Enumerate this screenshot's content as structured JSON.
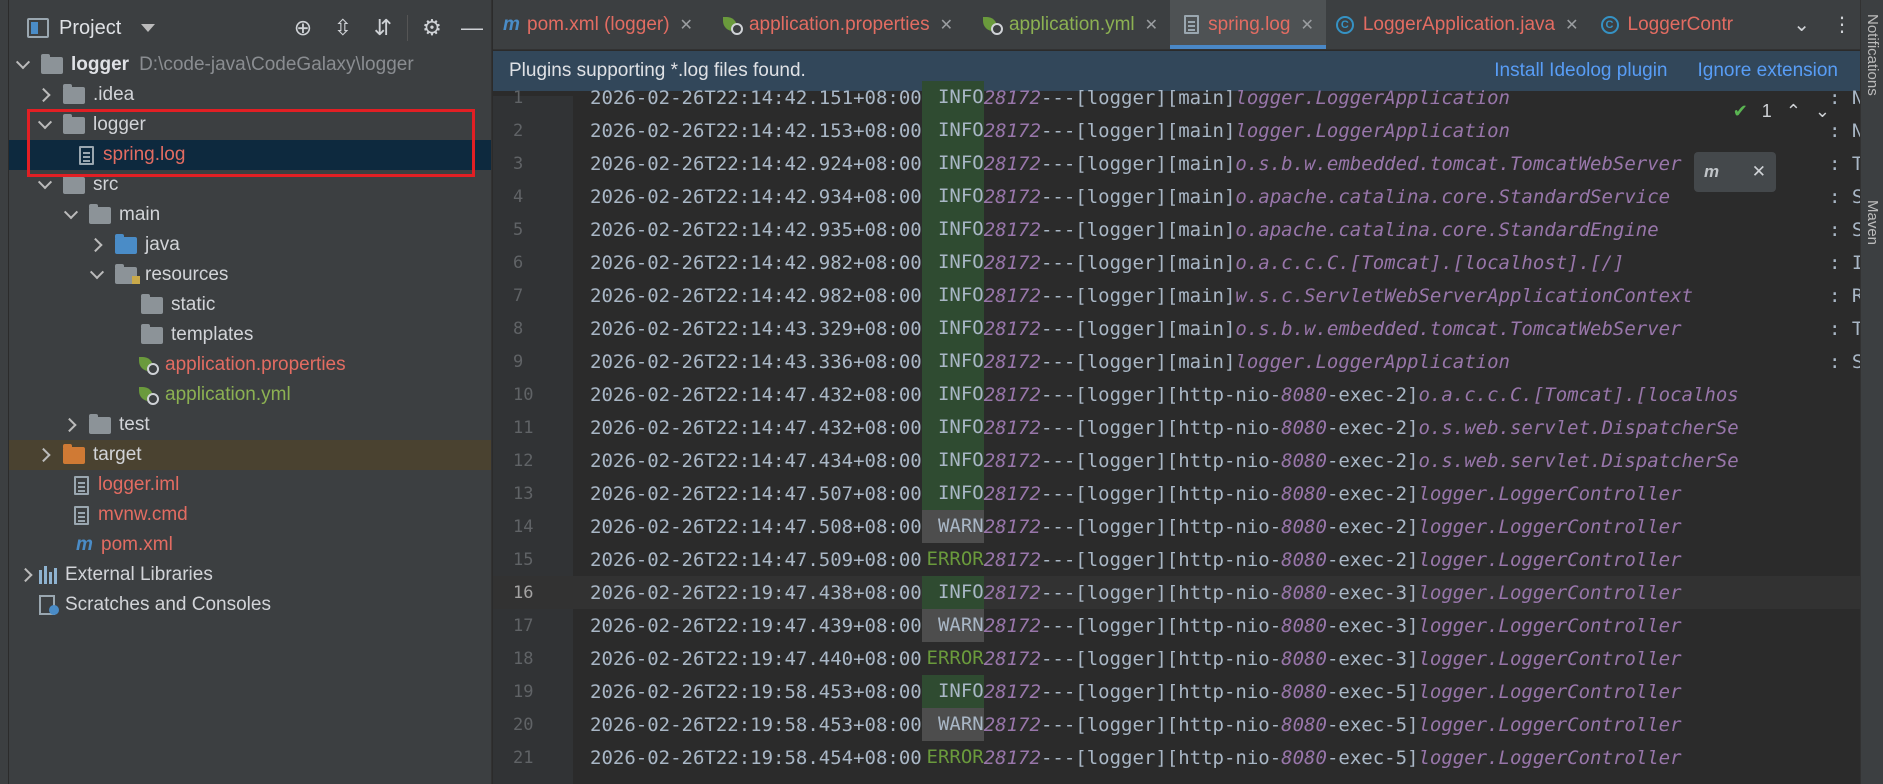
{
  "project_panel": {
    "title": "Project",
    "tools": [
      "crosshair-icon",
      "expand-all-icon",
      "collapse-all-icon",
      "gear-icon",
      "minimize-icon"
    ],
    "tree": [
      {
        "label": "logger",
        "path": "D:\\code-java\\CodeGalaxy\\logger",
        "icon": "folder-icon"
      },
      {
        "label": ".idea",
        "icon": "folder-icon"
      },
      {
        "label": "logger",
        "icon": "folder-icon"
      },
      {
        "label": "spring.log",
        "icon": "log-file-icon"
      },
      {
        "label": "src",
        "icon": "folder-icon"
      },
      {
        "label": "main",
        "icon": "folder-icon"
      },
      {
        "label": "java",
        "icon": "source-folder-icon"
      },
      {
        "label": "resources",
        "icon": "resources-folder-icon"
      },
      {
        "label": "static",
        "icon": "folder-icon"
      },
      {
        "label": "templates",
        "icon": "folder-icon"
      },
      {
        "label": "application.properties",
        "icon": "spring-config-icon"
      },
      {
        "label": "application.yml",
        "icon": "spring-config-icon"
      },
      {
        "label": "test",
        "icon": "folder-icon"
      },
      {
        "label": "target",
        "icon": "excluded-folder-icon"
      },
      {
        "label": "logger.iml",
        "icon": "module-file-icon"
      },
      {
        "label": "mvnw.cmd",
        "icon": "text-file-icon"
      },
      {
        "label": "pom.xml",
        "icon": "maven-icon"
      },
      {
        "label": "External Libraries",
        "icon": "libraries-icon"
      },
      {
        "label": "Scratches and Consoles",
        "icon": "scratches-icon"
      }
    ]
  },
  "tabs": [
    {
      "label": "pom.xml (logger)",
      "icon": "maven-icon",
      "color": "#e36c62"
    },
    {
      "label": "application.properties",
      "icon": "spring-config-icon",
      "color": "#e36c62"
    },
    {
      "label": "application.yml",
      "icon": "spring-config-icon",
      "color": "#8cb152"
    },
    {
      "label": "spring.log",
      "icon": "log-file-icon",
      "color": "#e36c62",
      "active": true
    },
    {
      "label": "LoggerApplication.java",
      "icon": "class-icon",
      "color": "#e36c62"
    },
    {
      "label": "LoggerContr",
      "icon": "class-icon",
      "color": "#e36c62"
    }
  ],
  "banner": {
    "message": "Plugins supporting *.log files found.",
    "install": "Install Ideolog plugin",
    "ignore": "Ignore extension"
  },
  "inspection": {
    "count": "1"
  },
  "maven_popup": {
    "label": "m",
    "close": "✕"
  },
  "right_strip": {
    "notifications": "Notifications",
    "maven": "Maven"
  },
  "log_lines": [
    {
      "n": "1",
      "ts": "2026-02-26T22:14:42.151+08:00",
      "level": "INFO",
      "pid": "28172",
      "app": "[logger]",
      "thread": "[main]",
      "cls": "logger.LoggerApplication",
      "tail": ": N"
    },
    {
      "n": "2",
      "ts": "2026-02-26T22:14:42.153+08:00",
      "level": "INFO",
      "pid": "28172",
      "app": "[logger]",
      "thread": "[main]",
      "cls": "logger.LoggerApplication",
      "tail": ": N"
    },
    {
      "n": "3",
      "ts": "2026-02-26T22:14:42.924+08:00",
      "level": "INFO",
      "pid": "28172",
      "app": "[logger]",
      "thread": "[main]",
      "cls": "o.s.b.w.embedded.tomcat.TomcatWebServer",
      "tail": ": T"
    },
    {
      "n": "4",
      "ts": "2026-02-26T22:14:42.934+08:00",
      "level": "INFO",
      "pid": "28172",
      "app": "[logger]",
      "thread": "[main]",
      "cls": "o.apache.catalina.core.StandardService",
      "tail": ": S"
    },
    {
      "n": "5",
      "ts": "2026-02-26T22:14:42.935+08:00",
      "level": "INFO",
      "pid": "28172",
      "app": "[logger]",
      "thread": "[main]",
      "cls": "o.apache.catalina.core.StandardEngine",
      "tail": ": S"
    },
    {
      "n": "6",
      "ts": "2026-02-26T22:14:42.982+08:00",
      "level": "INFO",
      "pid": "28172",
      "app": "[logger]",
      "thread": "[main]",
      "cls": "o.a.c.c.C.[Tomcat].[localhost].[/]",
      "tail": ": I"
    },
    {
      "n": "7",
      "ts": "2026-02-26T22:14:42.982+08:00",
      "level": "INFO",
      "pid": "28172",
      "app": "[logger]",
      "thread": "[main]",
      "cls": "w.s.c.ServletWebServerApplicationContext",
      "tail": ": R"
    },
    {
      "n": "8",
      "ts": "2026-02-26T22:14:43.329+08:00",
      "level": "INFO",
      "pid": "28172",
      "app": "[logger]",
      "thread": "[main]",
      "cls": "o.s.b.w.embedded.tomcat.TomcatWebServer",
      "tail": ": T"
    },
    {
      "n": "9",
      "ts": "2026-02-26T22:14:43.336+08:00",
      "level": "INFO",
      "pid": "28172",
      "app": "[logger]",
      "thread": "[main]",
      "cls": "logger.LoggerApplication",
      "tail": ": S"
    },
    {
      "n": "10",
      "ts": "2026-02-26T22:14:47.432+08:00",
      "level": "INFO",
      "pid": "28172",
      "app": "[logger]",
      "thread_a": "[http-nio-",
      "port": "8080",
      "thread_b": "-exec-2]",
      "cls": "o.a.c.c.C.[Tomcat].[localhos",
      "tail": ""
    },
    {
      "n": "11",
      "ts": "2026-02-26T22:14:47.432+08:00",
      "level": "INFO",
      "pid": "28172",
      "app": "[logger]",
      "thread_a": "[http-nio-",
      "port": "8080",
      "thread_b": "-exec-2]",
      "cls": "o.s.web.servlet.DispatcherSe",
      "tail": ""
    },
    {
      "n": "12",
      "ts": "2026-02-26T22:14:47.434+08:00",
      "level": "INFO",
      "pid": "28172",
      "app": "[logger]",
      "thread_a": "[http-nio-",
      "port": "8080",
      "thread_b": "-exec-2]",
      "cls": "o.s.web.servlet.DispatcherSe",
      "tail": ""
    },
    {
      "n": "13",
      "ts": "2026-02-26T22:14:47.507+08:00",
      "level": "INFO",
      "pid": "28172",
      "app": "[logger]",
      "thread_a": "[http-nio-",
      "port": "8080",
      "thread_b": "-exec-2]",
      "cls": "logger.LoggerController",
      "tail": ""
    },
    {
      "n": "14",
      "ts": "2026-02-26T22:14:47.508+08:00",
      "level": "WARN",
      "pid": "28172",
      "app": "[logger]",
      "thread_a": "[http-nio-",
      "port": "8080",
      "thread_b": "-exec-2]",
      "cls": "logger.LoggerController",
      "tail": ""
    },
    {
      "n": "15",
      "ts": "2026-02-26T22:14:47.509+08:00",
      "level": "ERROR",
      "pid": "28172",
      "app": "[logger]",
      "thread_a": "[http-nio-",
      "port": "8080",
      "thread_b": "-exec-2]",
      "cls": "logger.LoggerController",
      "tail": ""
    },
    {
      "n": "16",
      "ts": "2026-02-26T22:19:47.438+08:00",
      "level": "INFO",
      "pid": "28172",
      "app": "[logger]",
      "thread_a": "[http-nio-",
      "port": "8080",
      "thread_b": "-exec-3]",
      "cls": "logger.LoggerController",
      "tail": "",
      "current": true
    },
    {
      "n": "17",
      "ts": "2026-02-26T22:19:47.439+08:00",
      "level": "WARN",
      "pid": "28172",
      "app": "[logger]",
      "thread_a": "[http-nio-",
      "port": "8080",
      "thread_b": "-exec-3]",
      "cls": "logger.LoggerController",
      "tail": ""
    },
    {
      "n": "18",
      "ts": "2026-02-26T22:19:47.440+08:00",
      "level": "ERROR",
      "pid": "28172",
      "app": "[logger]",
      "thread_a": "[http-nio-",
      "port": "8080",
      "thread_b": "-exec-3]",
      "cls": "logger.LoggerController",
      "tail": ""
    },
    {
      "n": "19",
      "ts": "2026-02-26T22:19:58.453+08:00",
      "level": "INFO",
      "pid": "28172",
      "app": "[logger]",
      "thread_a": "[http-nio-",
      "port": "8080",
      "thread_b": "-exec-5]",
      "cls": "logger.LoggerController",
      "tail": ""
    },
    {
      "n": "20",
      "ts": "2026-02-26T22:19:58.453+08:00",
      "level": "WARN",
      "pid": "28172",
      "app": "[logger]",
      "thread_a": "[http-nio-",
      "port": "8080",
      "thread_b": "-exec-5]",
      "cls": "logger.LoggerController",
      "tail": ""
    },
    {
      "n": "21",
      "ts": "2026-02-26T22:19:58.454+08:00",
      "level": "ERROR",
      "pid": "28172",
      "app": "[logger]",
      "thread_a": "[http-nio-",
      "port": "8080",
      "thread_b": "-exec-5]",
      "cls": "logger.LoggerController",
      "tail": ""
    }
  ]
}
